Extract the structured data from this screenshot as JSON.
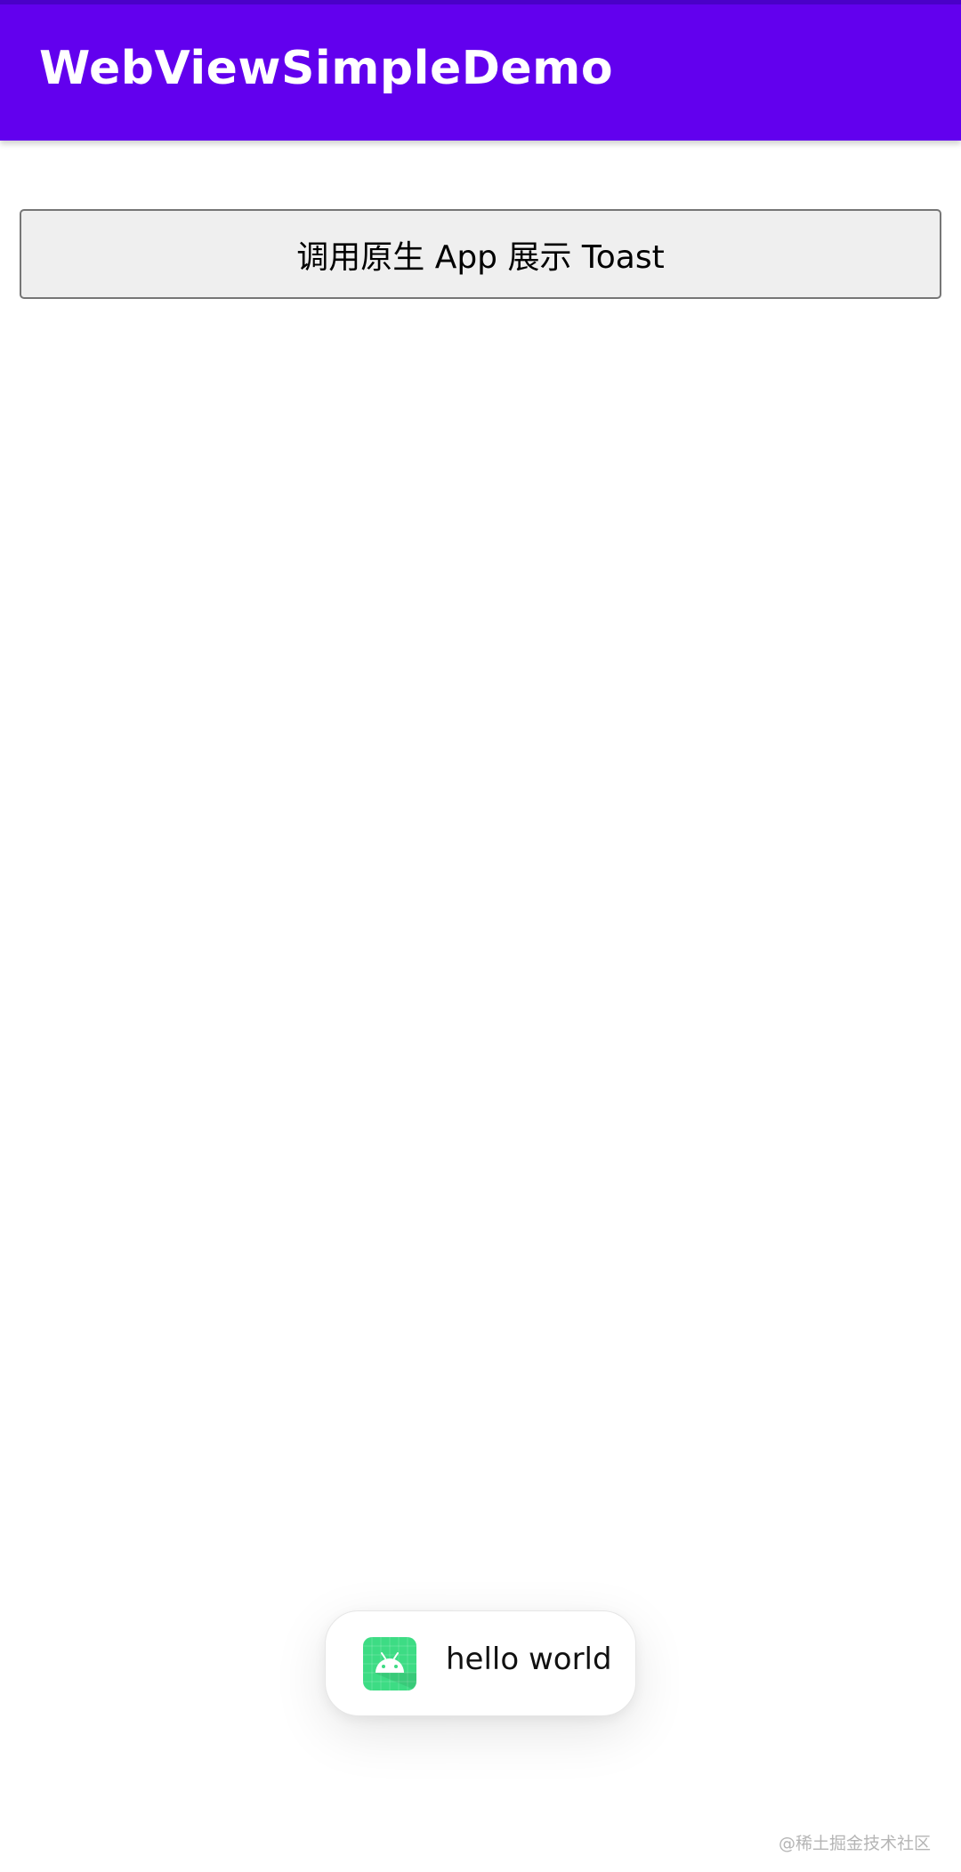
{
  "app_bar": {
    "title": "WebViewSimpleDemo",
    "color": "#6200EE"
  },
  "web_content": {
    "button_label": "调用原生 App 展示 Toast"
  },
  "toast": {
    "icon": "android-app-icon",
    "message": "hello world"
  },
  "watermark": {
    "text": "@稀土掘金技术社区"
  }
}
